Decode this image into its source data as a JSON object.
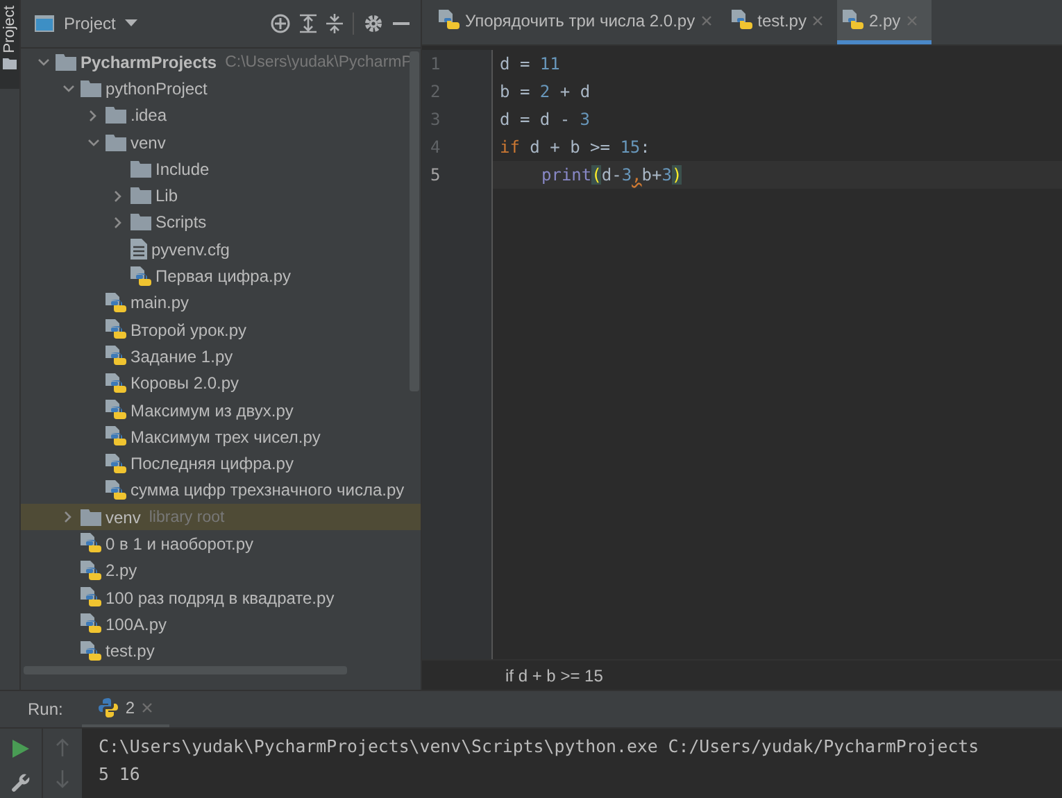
{
  "side_stripe": {
    "label": "Project"
  },
  "project_panel": {
    "title": "Project",
    "tree": [
      {
        "kind": "folder",
        "label": "PycharmProjects",
        "note": "C:\\Users\\yudak\\PycharmP",
        "expanded": true,
        "selected": false,
        "children": [
          {
            "kind": "folder",
            "label": "pythonProject",
            "expanded": true,
            "selected": false,
            "children": [
              {
                "kind": "folder",
                "label": ".idea",
                "expanded": false,
                "selected": false
              },
              {
                "kind": "folder",
                "label": "venv",
                "expanded": true,
                "selected": false,
                "children": [
                  {
                    "kind": "folder",
                    "label": "Include",
                    "selected": false
                  },
                  {
                    "kind": "folder",
                    "label": "Lib",
                    "expanded": false,
                    "selected": false
                  },
                  {
                    "kind": "folder",
                    "label": "Scripts",
                    "expanded": false,
                    "selected": false
                  },
                  {
                    "kind": "text",
                    "label": "pyvenv.cfg",
                    "selected": false
                  },
                  {
                    "kind": "python",
                    "label": "Первая цифра.py",
                    "selected": false
                  }
                ]
              },
              {
                "kind": "python",
                "label": "main.py",
                "selected": false
              },
              {
                "kind": "python",
                "label": "Второй урок.py",
                "selected": false
              },
              {
                "kind": "python",
                "label": "Задание 1.py",
                "selected": false
              },
              {
                "kind": "python",
                "label": "Коровы 2.0.py",
                "selected": false
              },
              {
                "kind": "python",
                "label": "Максимум из двух.py",
                "selected": false
              },
              {
                "kind": "python",
                "label": "Максимум трех чисел.py",
                "selected": false
              },
              {
                "kind": "python",
                "label": "Последняя цифра.py",
                "selected": false
              },
              {
                "kind": "python",
                "label": "сумма цифр трехзначного числа.py",
                "selected": false
              }
            ]
          },
          {
            "kind": "folder",
            "label": "venv",
            "note": "library root",
            "expanded": false,
            "selected": true
          },
          {
            "kind": "python",
            "label": "0 в 1 и наоборот.py",
            "selected": false
          },
          {
            "kind": "python",
            "label": "2.py",
            "selected": false
          },
          {
            "kind": "python",
            "label": "100 раз подряд в квадрате.py",
            "selected": false
          },
          {
            "kind": "python",
            "label": "100A.py",
            "selected": false
          },
          {
            "kind": "python",
            "label": "test.py",
            "selected": false
          }
        ]
      }
    ]
  },
  "editor": {
    "tabs": [
      {
        "label": "Упорядочить три числа 2.0.py",
        "selected": false
      },
      {
        "label": "test.py",
        "selected": false
      },
      {
        "label": "2.py",
        "selected": true
      }
    ],
    "lines": [
      {
        "number": "1",
        "current": false,
        "tokens": [
          {
            "kind": "plain",
            "text": "d = "
          },
          {
            "kind": "num",
            "text": "11"
          }
        ]
      },
      {
        "number": "2",
        "current": false,
        "tokens": [
          {
            "kind": "plain",
            "text": "b = "
          },
          {
            "kind": "num",
            "text": "2"
          },
          {
            "kind": "plain",
            "text": " + d"
          }
        ]
      },
      {
        "number": "3",
        "current": false,
        "tokens": [
          {
            "kind": "plain",
            "text": "d = d - "
          },
          {
            "kind": "num",
            "text": "3"
          }
        ]
      },
      {
        "number": "4",
        "current": false,
        "tokens": [
          {
            "kind": "kw",
            "text": "if"
          },
          {
            "kind": "plain",
            "text": " d + b >= "
          },
          {
            "kind": "num",
            "text": "15"
          },
          {
            "kind": "plain",
            "text": ":"
          }
        ]
      },
      {
        "number": "5",
        "current": true,
        "indented": true,
        "tokens": [
          {
            "kind": "fn",
            "text": "print"
          },
          {
            "kind": "match",
            "text": "("
          },
          {
            "kind": "plain",
            "text": "d-"
          },
          {
            "kind": "num",
            "text": "3"
          },
          {
            "kind": "warn",
            "text": ","
          },
          {
            "kind": "plain",
            "text": "b+"
          },
          {
            "kind": "num",
            "text": "3"
          },
          {
            "kind": "match",
            "text": ")"
          }
        ]
      }
    ],
    "breadcrumb": "if d + b >= 15"
  },
  "run_panel": {
    "label": "Run:",
    "tab": "2",
    "output": [
      "C:\\Users\\yudak\\PycharmProjects\\venv\\Scripts\\python.exe C:/Users/yudak/PycharmProjects",
      "5 16"
    ]
  }
}
